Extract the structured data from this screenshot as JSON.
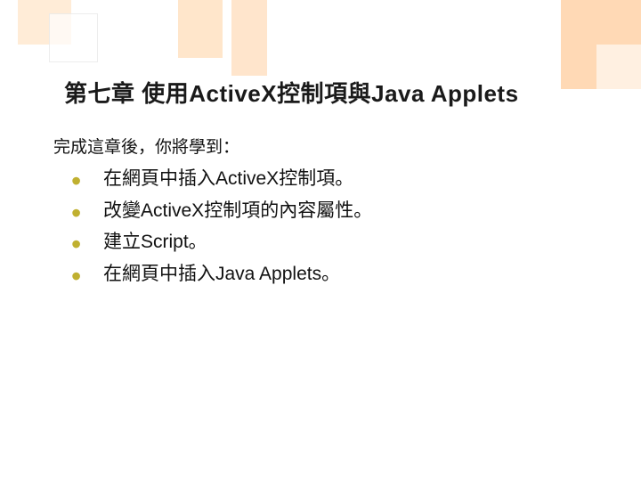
{
  "slide": {
    "title": "第七章  使用ActiveX控制項與Java Applets",
    "intro": "完成這章後，你將學到：",
    "bullets": [
      "在網頁中插入ActiveX控制項。",
      "改變ActiveX控制項的內容屬性。",
      "建立Script。",
      "在網頁中插入Java Applets。"
    ]
  }
}
